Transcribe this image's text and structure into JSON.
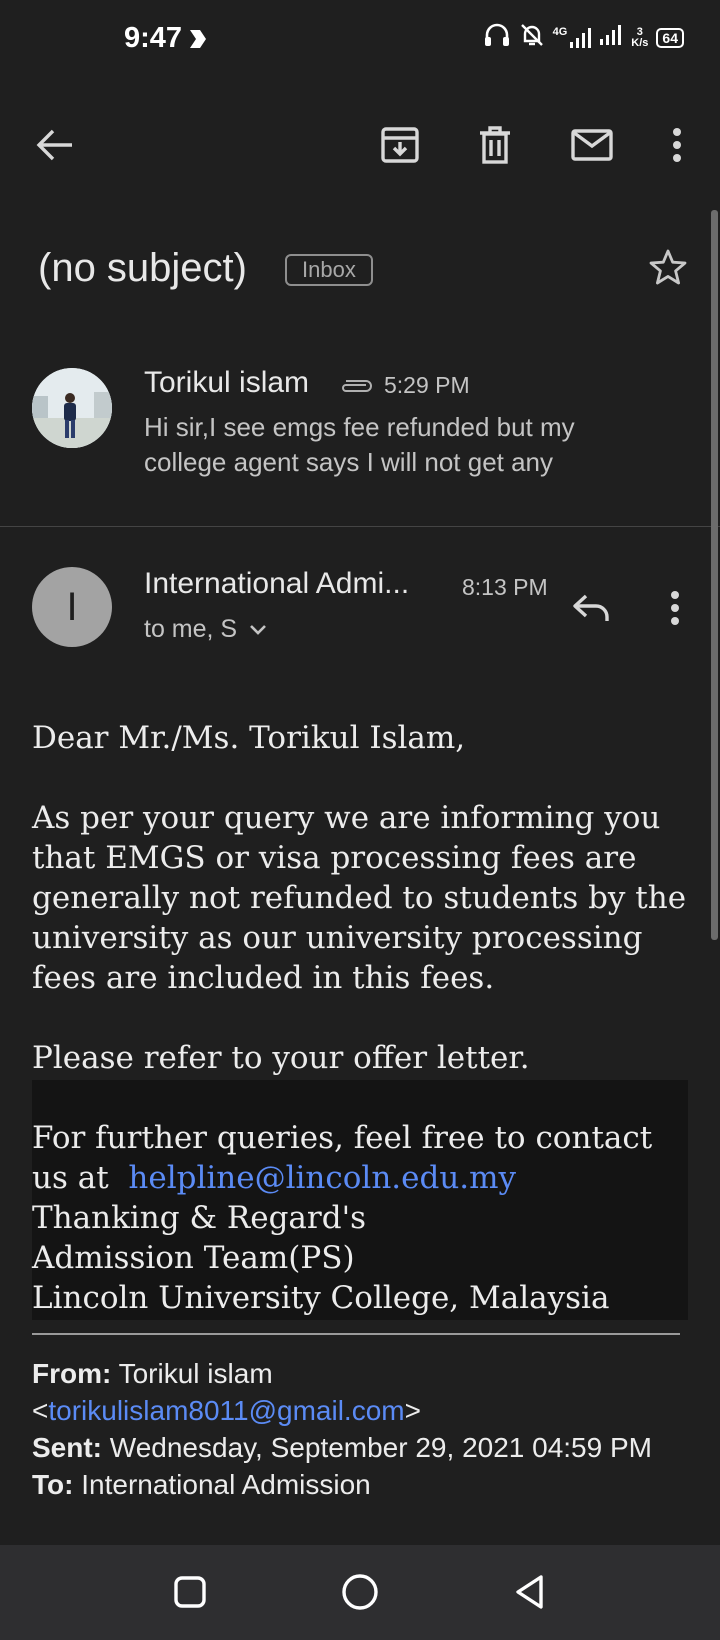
{
  "status_bar": {
    "time": "9:47",
    "network_type": "4G",
    "speed_value": "3",
    "speed_unit": "K/s",
    "battery": "64"
  },
  "toolbar": {
    "icons": [
      "back-arrow-icon",
      "archive-icon",
      "delete-icon",
      "mark-unread-icon",
      "more-vert-icon"
    ]
  },
  "email": {
    "subject": "(no subject)",
    "label": "Inbox"
  },
  "message1": {
    "sender": "Torikul islam",
    "time": "5:29 PM",
    "snippet": "Hi sir,I see emgs fee refunded but my college agent says I will not get any"
  },
  "message2": {
    "avatar_letter": "I",
    "sender": "International Admi...",
    "time": "8:13 PM",
    "recipients": "to me, S"
  },
  "body": {
    "greeting": "Dear Mr./Ms. Torikul Islam,",
    "paragraph1": "As per your query we are informing you that EMGS or visa processing fees are generally not refunded to students by the university as our university processing fees are included in this fees.",
    "paragraph2": "Please refer to your offer letter.",
    "contact_text": "For further queries, feel free to contact us at",
    "contact_email": "helpline@lincoln.edu.my",
    "sign1": "Thanking & Regard's",
    "sign2": "Admission Team(PS)",
    "sign3": "Lincoln University College, Malaysia"
  },
  "quoted": {
    "from_label": "From:",
    "from_name": "Torikul islam",
    "from_email": "torikulislam8011@gmail.com",
    "sent_label": "Sent:",
    "sent_value": "Wednesday, September 29, 2021 04:59 PM",
    "to_label": "To:",
    "to_value": "International Admission"
  },
  "colors": {
    "background": "#1f1f1f",
    "link": "#5b8bf5",
    "nav_bar": "#2e2e30"
  }
}
